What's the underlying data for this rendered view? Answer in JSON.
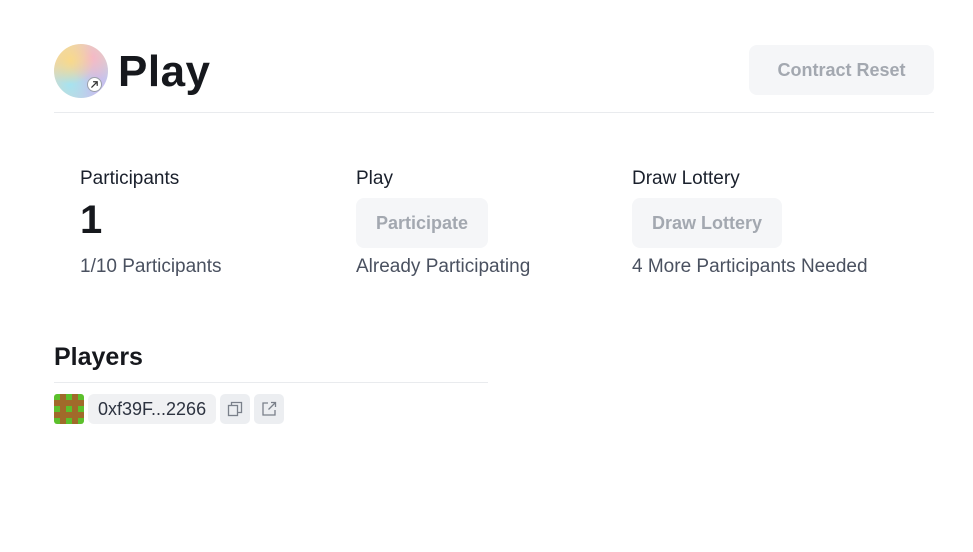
{
  "header": {
    "title": "Play",
    "reset_label": "Contract Reset"
  },
  "stats": [
    {
      "label": "Participants",
      "value": "1",
      "sub": "1/10 Participants"
    },
    {
      "label": "Play",
      "button": "Participate",
      "sub": "Already Participating"
    },
    {
      "label": "Draw Lottery",
      "button": "Draw Lottery",
      "sub": "4 More Participants Needed"
    }
  ],
  "players": {
    "title": "Players",
    "list": [
      {
        "address": "0xf39F...2266"
      }
    ]
  },
  "icons": {
    "logo_badge": "external-link-icon",
    "copy": "copy-icon",
    "open": "external-link-icon"
  },
  "colors": {
    "button_bg": "#f5f6f8",
    "button_text": "#a3a8b0",
    "avatar_green": "#5cc02c",
    "avatar_brown": "#a06a2a"
  }
}
